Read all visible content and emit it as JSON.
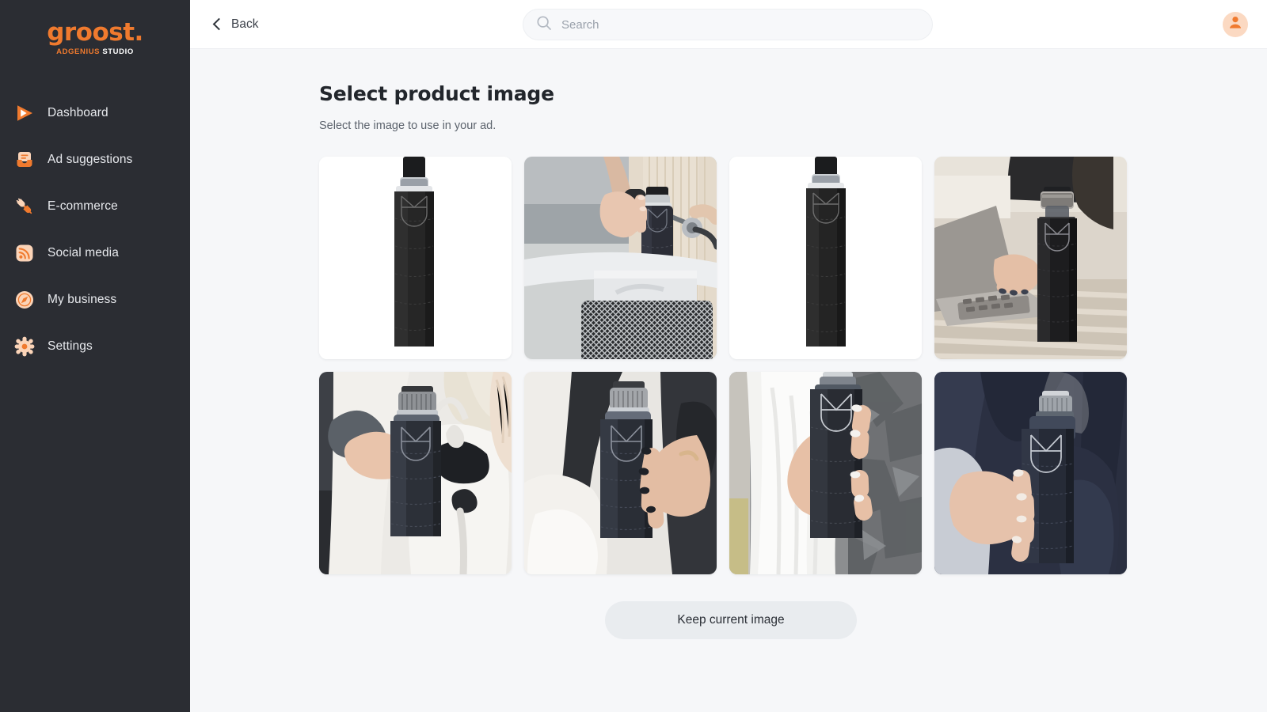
{
  "brand": {
    "name": "groost.",
    "tagline_primary": "ADGENIUS",
    "tagline_secondary": "STUDIO"
  },
  "sidebar": {
    "items": [
      {
        "label": "Dashboard",
        "icon": "play-icon"
      },
      {
        "label": "Ad suggestions",
        "icon": "inbox-icon"
      },
      {
        "label": "E-commerce",
        "icon": "plug-icon"
      },
      {
        "label": "Social media",
        "icon": "rss-icon"
      },
      {
        "label": "My business",
        "icon": "compass-icon"
      },
      {
        "label": "Settings",
        "icon": "gear-icon"
      }
    ]
  },
  "topbar": {
    "back_label": "Back",
    "back_icon": "chevron-left-icon",
    "search_placeholder": "Search",
    "search_value": "",
    "search_icon": "search-icon",
    "avatar_icon": "user-avatar-icon"
  },
  "main": {
    "title": "Select product image",
    "subtitle": "Select the image to use in your ad.",
    "keep_button_label": "Keep current image"
  },
  "gallery": {
    "images": [
      {
        "alt": "Black leather-sleeved glass water bottle on white studio background",
        "scene": "studio-white"
      },
      {
        "alt": "Woman placing bottle into white bicycle basket",
        "scene": "bicycle-basket"
      },
      {
        "alt": "Black leather-sleeved glass water bottle on white studio background",
        "scene": "studio-white-2"
      },
      {
        "alt": "Bottle standing beside a laptop on a striped bench",
        "scene": "laptop-bench"
      },
      {
        "alt": "Hand holding the bottle next to a white handbag",
        "scene": "white-handbag"
      },
      {
        "alt": "Manicured hand holding the bottle on white trousers",
        "scene": "white-trousers"
      },
      {
        "alt": "Woman in white dress holding bottle outdoors by rocks",
        "scene": "outdoor-rocks"
      },
      {
        "alt": "Woman in navy activewear holding the bottle",
        "scene": "navy-activewear"
      }
    ]
  },
  "colors": {
    "brand_orange": "#f07a2e",
    "sidebar_bg": "#2b2d33",
    "page_bg": "#f6f7f9",
    "button_bg": "#e9ecef"
  }
}
